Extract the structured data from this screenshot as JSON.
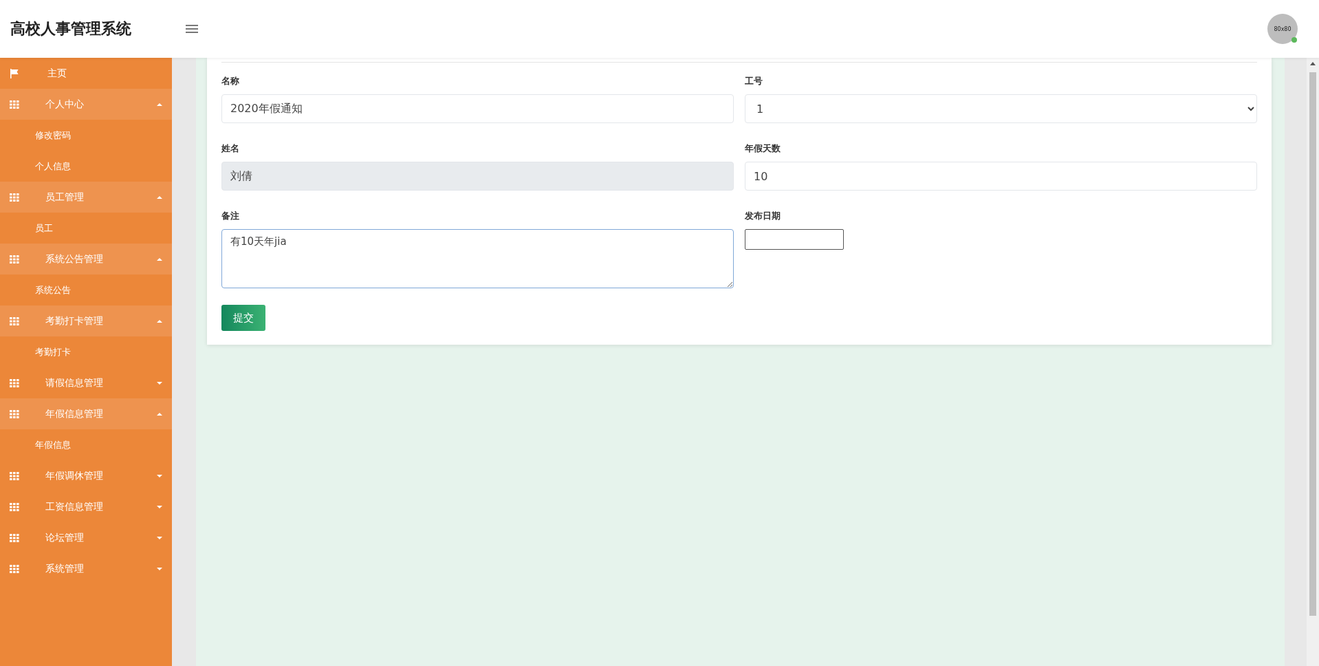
{
  "header": {
    "title": "高校人事管理系统",
    "avatar_text": "80x80",
    "online": true
  },
  "sidebar": {
    "items": [
      {
        "label": "主页",
        "kind": "link",
        "expanded": false
      },
      {
        "label": "个人中心",
        "kind": "group",
        "expanded": true,
        "children": [
          {
            "label": "修改密码"
          },
          {
            "label": "个人信息"
          }
        ]
      },
      {
        "label": "员工管理",
        "kind": "group",
        "expanded": true,
        "children": [
          {
            "label": "员工"
          }
        ]
      },
      {
        "label": "系统公告管理",
        "kind": "group",
        "expanded": true,
        "children": [
          {
            "label": "系统公告"
          }
        ]
      },
      {
        "label": "考勤打卡管理",
        "kind": "group",
        "expanded": true,
        "children": [
          {
            "label": "考勤打卡"
          }
        ]
      },
      {
        "label": "请假信息管理",
        "kind": "group",
        "expanded": false
      },
      {
        "label": "年假信息管理",
        "kind": "group",
        "expanded": true,
        "children": [
          {
            "label": "年假信息"
          }
        ]
      },
      {
        "label": "年假调休管理",
        "kind": "group",
        "expanded": false
      },
      {
        "label": "工资信息管理",
        "kind": "group",
        "expanded": false
      },
      {
        "label": "论坛管理",
        "kind": "group",
        "expanded": false
      },
      {
        "label": "系统管理",
        "kind": "group",
        "expanded": false
      }
    ]
  },
  "form": {
    "fields": [
      {
        "label": "名称",
        "kind": "text",
        "value": "2020年假通知",
        "disabled": false,
        "focused": false
      },
      {
        "label": "工号",
        "kind": "select",
        "value": "1",
        "disabled": false,
        "focused": false
      },
      {
        "label": "姓名",
        "kind": "text",
        "value": "刘倩",
        "disabled": true,
        "focused": false
      },
      {
        "label": "年假天数",
        "kind": "text",
        "value": "10",
        "disabled": false,
        "focused": false
      },
      {
        "label": "备注",
        "kind": "textarea",
        "value": "有10天年jia",
        "disabled": false,
        "focused": true
      },
      {
        "label": "发布日期",
        "kind": "date",
        "disabled": false,
        "focused": false
      }
    ],
    "submit": "提交"
  }
}
